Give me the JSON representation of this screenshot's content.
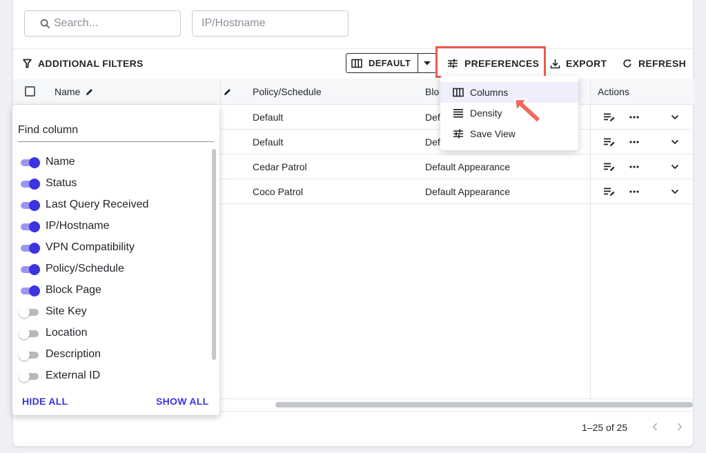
{
  "filters": {
    "search_placeholder": "Search...",
    "ip_placeholder": "IP/Hostname"
  },
  "toolbar": {
    "additional_filters": "ADDITIONAL FILTERS",
    "view_label": "DEFAULT",
    "preferences": "PREFERENCES",
    "export": "EXPORT",
    "refresh": "REFRESH"
  },
  "table": {
    "headers": {
      "name": "Name",
      "policy": "Policy/Schedule",
      "block": "Blo",
      "actions": "Actions"
    },
    "rows": [
      {
        "policy": "Default",
        "block": "Def"
      },
      {
        "policy": "Default",
        "block": "Def"
      },
      {
        "policy": "Cedar Patrol",
        "block": "Default Appearance"
      },
      {
        "policy": "Coco Patrol",
        "block": "Default Appearance"
      }
    ]
  },
  "columns_panel": {
    "find_placeholder": "Find column",
    "items": [
      {
        "label": "Name",
        "enabled": true
      },
      {
        "label": "Status",
        "enabled": true
      },
      {
        "label": "Last Query Received",
        "enabled": true
      },
      {
        "label": "IP/Hostname",
        "enabled": true
      },
      {
        "label": "VPN Compatibility",
        "enabled": true
      },
      {
        "label": "Policy/Schedule",
        "enabled": true
      },
      {
        "label": "Block Page",
        "enabled": true
      },
      {
        "label": "Site Key",
        "enabled": false
      },
      {
        "label": "Location",
        "enabled": false
      },
      {
        "label": "Description",
        "enabled": false
      },
      {
        "label": "External ID",
        "enabled": false
      }
    ],
    "hide_all": "HIDE ALL",
    "show_all": "SHOW ALL"
  },
  "preferences_menu": {
    "items": [
      {
        "label": "Columns",
        "icon": "columns-icon"
      },
      {
        "label": "Density",
        "icon": "density-icon"
      },
      {
        "label": "Save View",
        "icon": "sliders-icon"
      }
    ]
  },
  "pagination": {
    "range": "1–25 of 25"
  },
  "colors": {
    "accent": "#3d33e0",
    "highlight": "#ec5a4e"
  }
}
